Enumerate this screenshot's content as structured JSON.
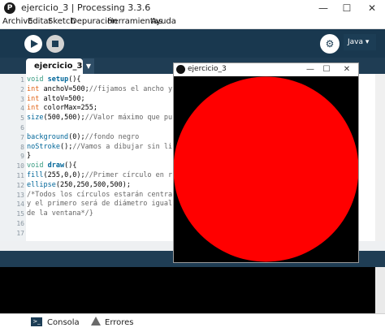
{
  "window": {
    "title": "ejercicio_3 | Processing 3.3.6",
    "app_icon": "processing-logo-icon",
    "controls": [
      "—",
      "☐",
      "✕"
    ]
  },
  "menu": [
    "Archivo",
    "Editar",
    "Sketch",
    "Depuración",
    "Herramientas",
    "Ayuda"
  ],
  "toolbar": {
    "run_icon": "play-icon",
    "stop_icon": "stop-icon",
    "debug_icon": "debug-icon",
    "mode": "Java ▾"
  },
  "tabs": [
    {
      "label": "ejercicio_3"
    }
  ],
  "tab_menu": "▼",
  "editor": {
    "line_numbers": [
      "1",
      "2",
      "3",
      "4",
      "5",
      "6",
      "7",
      "8",
      "9",
      "10",
      "11",
      "12",
      "13",
      "14",
      "15",
      "16",
      "17"
    ],
    "lines": [
      [
        {
          "t": "void ",
          "c": "kw"
        },
        {
          "t": "setup",
          "c": "fn"
        },
        {
          "t": "(){",
          "c": ""
        }
      ],
      [
        {
          "t": "int ",
          "c": "ty"
        },
        {
          "t": "anchoV=500;",
          "c": ""
        },
        {
          "t": "//fijamos el ancho y",
          "c": "cm"
        }
      ],
      [
        {
          "t": "int ",
          "c": "ty"
        },
        {
          "t": "altoV=500;",
          "c": ""
        }
      ],
      [
        {
          "t": "int ",
          "c": "ty"
        },
        {
          "t": "colorMax=255;",
          "c": ""
        }
      ],
      [
        {
          "t": "size",
          "c": "fn2"
        },
        {
          "t": "(500,500);",
          "c": ""
        },
        {
          "t": "//Valor máximo que pu",
          "c": "cm"
        }
      ],
      [
        {
          "t": "",
          "c": ""
        }
      ],
      [
        {
          "t": "background",
          "c": "fn2"
        },
        {
          "t": "(0);",
          "c": ""
        },
        {
          "t": "//fondo negro",
          "c": "cm"
        }
      ],
      [
        {
          "t": "noStroke",
          "c": "fn2"
        },
        {
          "t": "();",
          "c": ""
        },
        {
          "t": "//Vamos a dibujar sin li",
          "c": "cm"
        }
      ],
      [
        {
          "t": "}",
          "c": ""
        }
      ],
      [
        {
          "t": "void ",
          "c": "kw"
        },
        {
          "t": "draw",
          "c": "fn"
        },
        {
          "t": "(){",
          "c": ""
        }
      ],
      [
        {
          "t": "fill",
          "c": "fn2"
        },
        {
          "t": "(255,0,0);",
          "c": ""
        },
        {
          "t": "//Primer círculo en r",
          "c": "cm"
        }
      ],
      [
        {
          "t": "ellipse",
          "c": "fn2"
        },
        {
          "t": "(250,250,500,500);",
          "c": ""
        }
      ],
      [
        {
          "t": "/*Todos los círculos estarán centra",
          "c": "cm"
        }
      ],
      [
        {
          "t": "y el primero será de diámetro igual",
          "c": "cm"
        }
      ],
      [
        {
          "t": "de la ventana*/}",
          "c": "cm"
        }
      ]
    ]
  },
  "sketch_window": {
    "title": "ejercicio_3",
    "controls": [
      "—",
      "☐",
      "✕"
    ],
    "background": "#000000",
    "circle_color": "#ff0000"
  },
  "bottom_tabs": {
    "console": "Consola",
    "errors": "Errores"
  },
  "colors": {
    "accent": "#1c3d55",
    "circle": "#ff0000"
  }
}
